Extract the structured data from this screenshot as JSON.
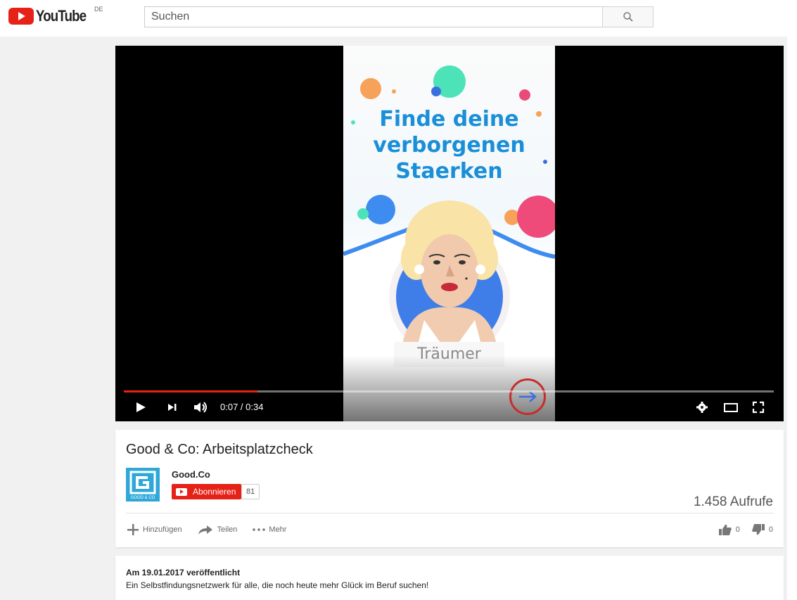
{
  "masthead": {
    "logo_text": "YouTube",
    "region": "DE",
    "search_placeholder": "Suchen"
  },
  "player": {
    "headline_lines": [
      "Finde deine",
      "verborgenen",
      "Staerken"
    ],
    "role_label": "Träumer",
    "time_display": "0:07 / 0:34",
    "progress_fraction": 0.206
  },
  "video": {
    "title": "Good & Co: Arbeitsplatzcheck",
    "channel": "Good.Co",
    "avatar_caption": "GOOD & CO",
    "subscribe_label": "Abonnieren",
    "subscriber_count": "81",
    "views": "1.458 Aufrufe",
    "actions": {
      "add": "Hinzufügen",
      "share": "Teilen",
      "more": "Mehr"
    },
    "likes": "0",
    "dislikes": "0"
  },
  "description": {
    "published": "Am 19.01.2017 veröffentlicht",
    "text": "Ein Selbstfindungsnetzwerk für alle, die noch heute mehr Glück im Beruf suchen!"
  },
  "colors": {
    "brand_red": "#e62117",
    "headline_blue": "#1a8fd8"
  }
}
